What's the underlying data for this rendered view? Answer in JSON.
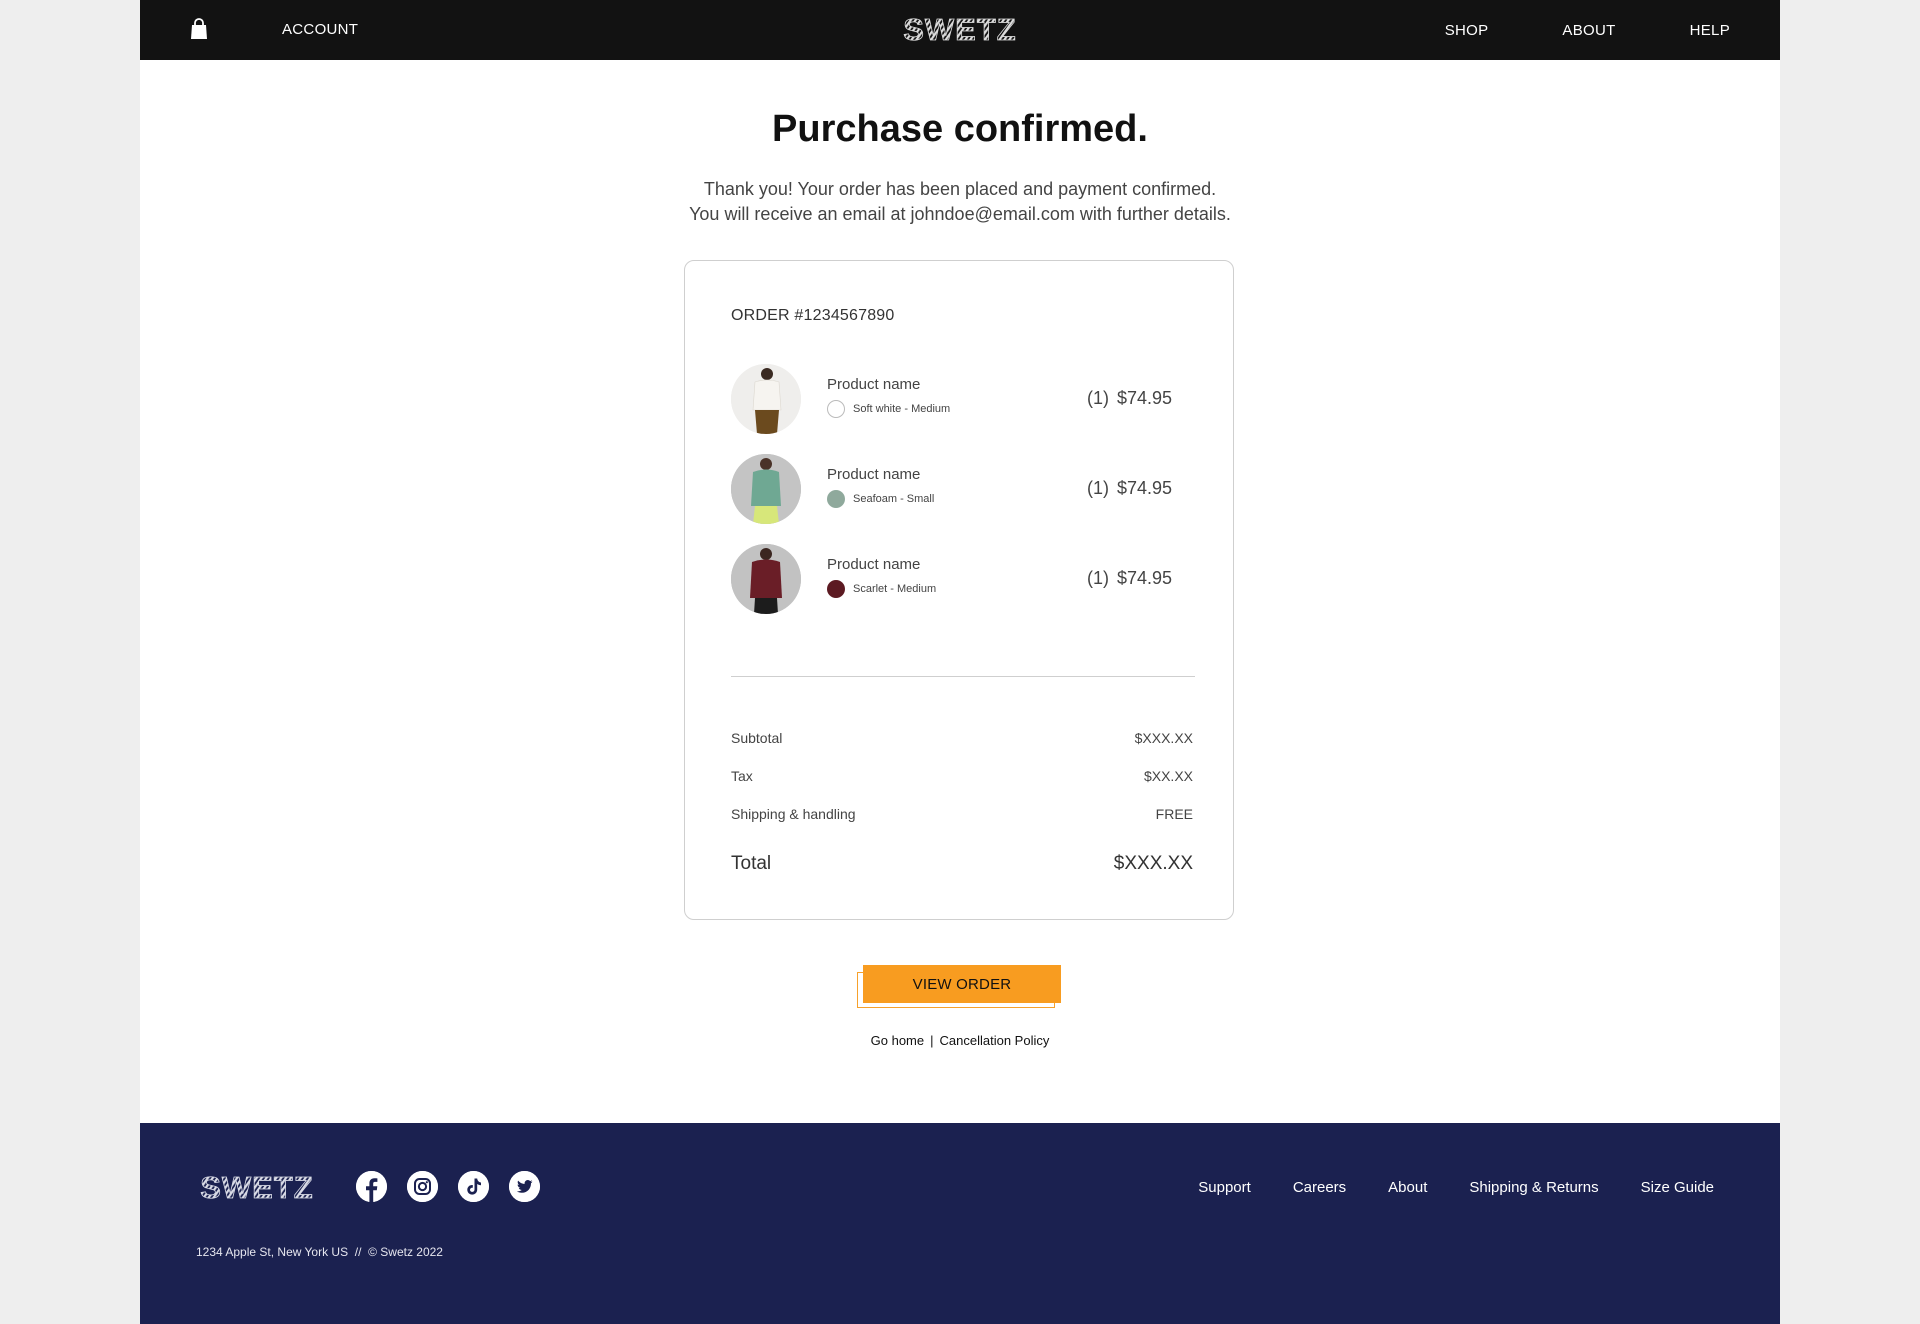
{
  "header": {
    "logo_text": "SWETZ",
    "account_label": "ACCOUNT",
    "nav": [
      "SHOP",
      "ABOUT",
      "HELP"
    ],
    "cart_icon": "shopping-bag-icon"
  },
  "confirmation": {
    "title": "Purchase confirmed.",
    "line1": "Thank you! Your order has been placed and payment confirmed.",
    "line2": "You will receive an email at johndoe@email.com with further details."
  },
  "order": {
    "number_label": "ORDER #1234567890",
    "items": [
      {
        "name": "Product name",
        "variant": "Soft white - Medium",
        "swatch_color": "#ffffff",
        "qty": "(1)",
        "price": "$74.95"
      },
      {
        "name": "Product name",
        "variant": "Seafoam - Small",
        "swatch_color": "#8fa99c",
        "qty": "(1)",
        "price": "$74.95"
      },
      {
        "name": "Product name",
        "variant": "Scarlet - Medium",
        "swatch_color": "#5c1a22",
        "qty": "(1)",
        "price": "$74.95"
      }
    ],
    "summary": {
      "subtotal_label": "Subtotal",
      "subtotal_value": "$XXX.XX",
      "tax_label": "Tax",
      "tax_value": "$XX.XX",
      "shipping_label": "Shipping & handling",
      "shipping_value": "FREE",
      "total_label": "Total",
      "total_value": "$XXX.XX"
    }
  },
  "actions": {
    "view_order_label": "VIEW ORDER",
    "go_home_label": "Go home",
    "separator": "|",
    "cancellation_label": "Cancellation Policy"
  },
  "footer": {
    "logo_text": "SWETZ",
    "socials": [
      "facebook-icon",
      "instagram-icon",
      "tiktok-icon",
      "twitter-icon"
    ],
    "links": [
      "Support",
      "Careers",
      "About",
      "Shipping & Returns",
      "Size Guide"
    ],
    "address": "1234 Apple St, New York US  //  © Swetz 2022"
  },
  "colors": {
    "header_bg": "#121212",
    "footer_bg": "#1b2150",
    "accent": "#f89c20"
  }
}
